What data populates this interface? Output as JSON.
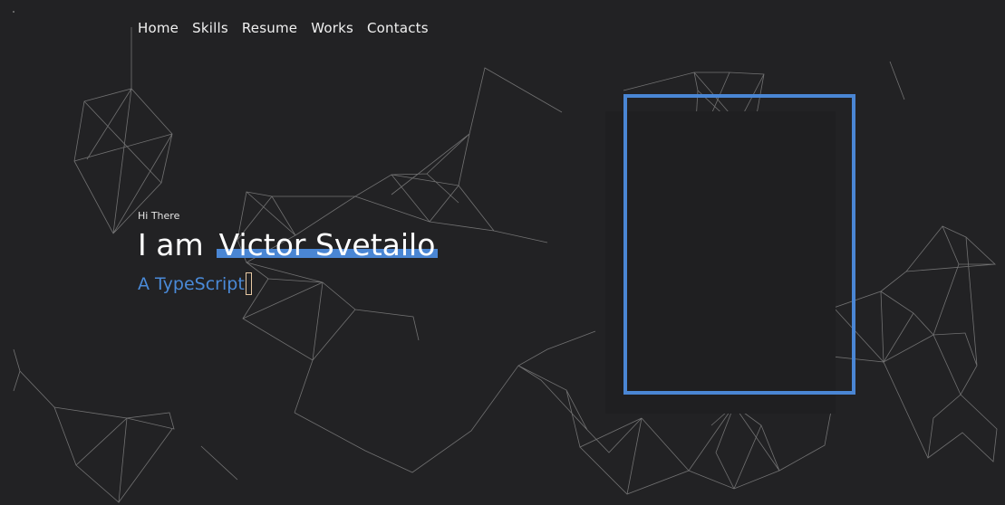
{
  "nav": {
    "items": [
      {
        "label": "Home"
      },
      {
        "label": "Skills"
      },
      {
        "label": "Resume"
      },
      {
        "label": "Works"
      },
      {
        "label": "Contacts"
      }
    ]
  },
  "hero": {
    "greeting": "Hi There",
    "headline_prefix": "I am",
    "name": "Victor Svetailo",
    "role_typed": "A TypeScript"
  },
  "colors": {
    "background": "#222224",
    "accent": "#4a86d4",
    "network_lines": "#9a9a9a",
    "cursor": "#e8c9a3"
  },
  "icons": {
    "text_cursor": "typing-cursor-icon"
  }
}
